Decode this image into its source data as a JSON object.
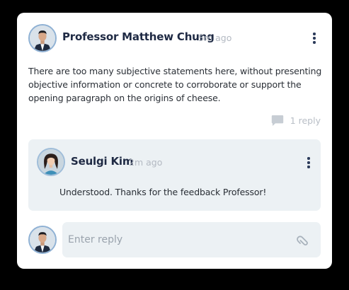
{
  "comment": {
    "author": "Professor Matthew Chung",
    "time": "5m ago",
    "body": "There are too many subjective statements here, without presenting objective information or concrete to corroborate or support the opening paragraph on the origins of cheese.",
    "reply_count": "1 reply"
  },
  "reply": {
    "author": "Seulgi Kim",
    "time": "2m ago",
    "body": "Understood. Thanks for the feedback Professor!"
  },
  "reply_input": {
    "placeholder": "Enter reply",
    "value": ""
  },
  "icons": {
    "comment_menu": "more-vertical-icon",
    "reply_count": "chat-bubble-icon",
    "reply_menu": "more-vertical-icon",
    "attach": "paperclip-icon"
  },
  "colors": {
    "page_background": "#000000",
    "card_background": "#ffffff",
    "reply_background": "#ecf1f4",
    "name_text": "#1f2a44",
    "muted_text": "#b3b9c2",
    "body_text": "#2a2f36",
    "menu_icon": "#2c3b5a"
  }
}
